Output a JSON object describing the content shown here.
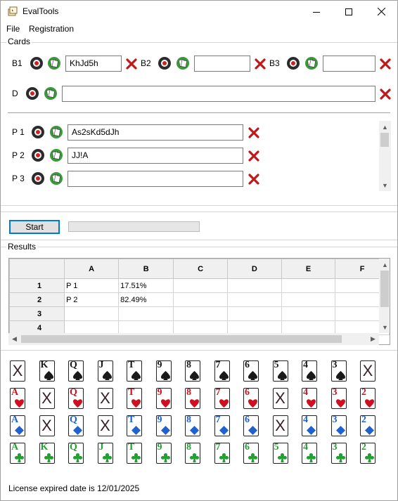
{
  "window": {
    "title": "EvalTools",
    "minimize_icon": "minimize-icon",
    "maximize_icon": "maximize-icon",
    "close_icon": "close-icon"
  },
  "menu": {
    "file": "File",
    "registration": "Registration"
  },
  "cards_group": {
    "label": "Cards",
    "board": [
      {
        "label": "B1",
        "value": "KhJd5h"
      },
      {
        "label": "B2",
        "value": ""
      },
      {
        "label": "B3",
        "value": ""
      }
    ],
    "dead": {
      "label": "D",
      "value": ""
    },
    "players": [
      {
        "label": "P 1",
        "value": "As2sKd5dJh"
      },
      {
        "label": "P 2",
        "value": "JJ!A"
      },
      {
        "label": "P 3",
        "value": ""
      }
    ]
  },
  "actions": {
    "start_label": "Start",
    "progress": 0
  },
  "results": {
    "label": "Results",
    "columns": [
      "A",
      "B",
      "C",
      "D",
      "E",
      "F"
    ],
    "rows": [
      {
        "num": "1",
        "cells": [
          "P 1",
          "17.51%",
          "",
          "",
          "",
          ""
        ]
      },
      {
        "num": "2",
        "cells": [
          "P 2",
          "82.49%",
          "",
          "",
          "",
          ""
        ]
      },
      {
        "num": "3",
        "cells": [
          "",
          "",
          "",
          "",
          "",
          ""
        ]
      },
      {
        "num": "4",
        "cells": [
          "",
          "",
          "",
          "",
          "",
          ""
        ]
      }
    ]
  },
  "deck": {
    "colors": {
      "spade": "#1a1a1a",
      "heart": "#d01020",
      "diamond": "#2060d0",
      "club": "#20a030"
    },
    "rows": [
      {
        "suit": "spade",
        "cards": [
          "X",
          "K",
          "Q",
          "J",
          "T",
          "9",
          "8",
          "7",
          "6",
          "5",
          "4",
          "3",
          "X"
        ]
      },
      {
        "suit": "heart",
        "cards": [
          "A",
          "X",
          "Q",
          "X",
          "T",
          "9",
          "8",
          "7",
          "6",
          "X",
          "4",
          "3",
          "2"
        ]
      },
      {
        "suit": "diamond",
        "cards": [
          "A",
          "X",
          "Q",
          "X",
          "T",
          "9",
          "8",
          "7",
          "6",
          "X",
          "4",
          "3",
          "2"
        ]
      },
      {
        "suit": "club",
        "cards": [
          "A",
          "K",
          "Q",
          "J",
          "T",
          "9",
          "8",
          "7",
          "6",
          "5",
          "4",
          "3",
          "2"
        ]
      }
    ]
  },
  "status": {
    "license": "License expired date is 12/01/2025"
  }
}
